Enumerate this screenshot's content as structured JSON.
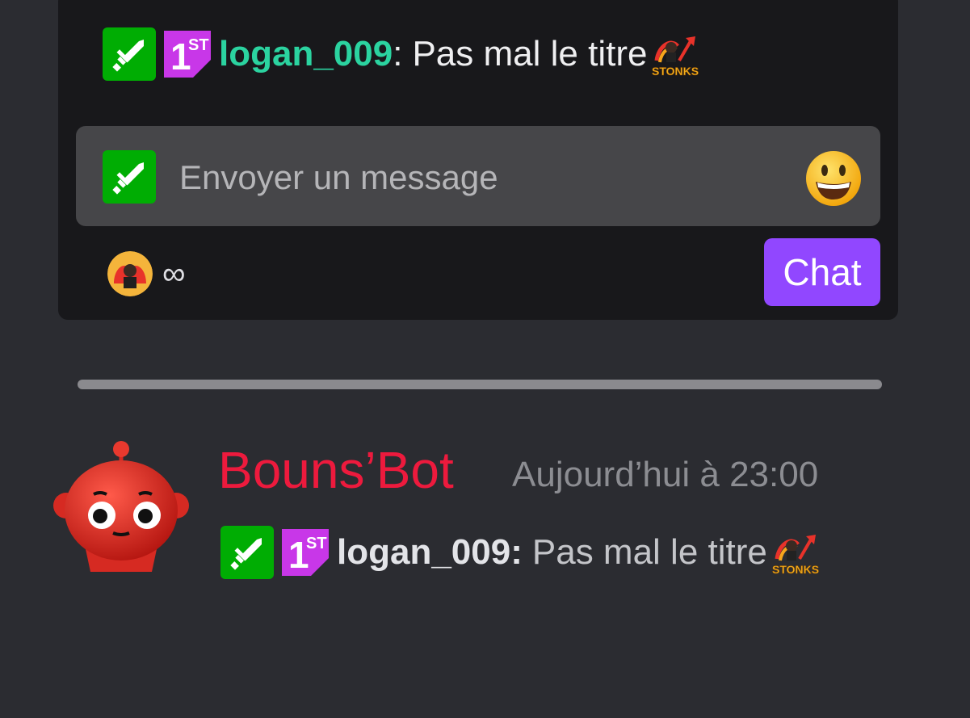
{
  "twitch_chat": {
    "message": {
      "username": "logan_009",
      "separator": ":",
      "text": "Pas mal le titre",
      "emote": "stonks-emote",
      "emote_label": "STONKS"
    },
    "input": {
      "placeholder": "Envoyer un message"
    },
    "channel_points": {
      "value": "∞"
    },
    "send_button": {
      "label": "Chat"
    },
    "colors": {
      "accent": "#9147ff",
      "username": "#2bd3a0",
      "mod_badge": "#00ad03",
      "first_badge": "#c837e8"
    }
  },
  "discord": {
    "bot_name": "Bouns’Bot",
    "timestamp": "Aujourd’hui à 23:00",
    "message": {
      "username": "logan_009",
      "separator": ":",
      "text": "Pas mal le titre",
      "emote": "stonks-emote",
      "emote_label": "STONKS"
    },
    "colors": {
      "bot_name": "#ed1a3d"
    }
  }
}
